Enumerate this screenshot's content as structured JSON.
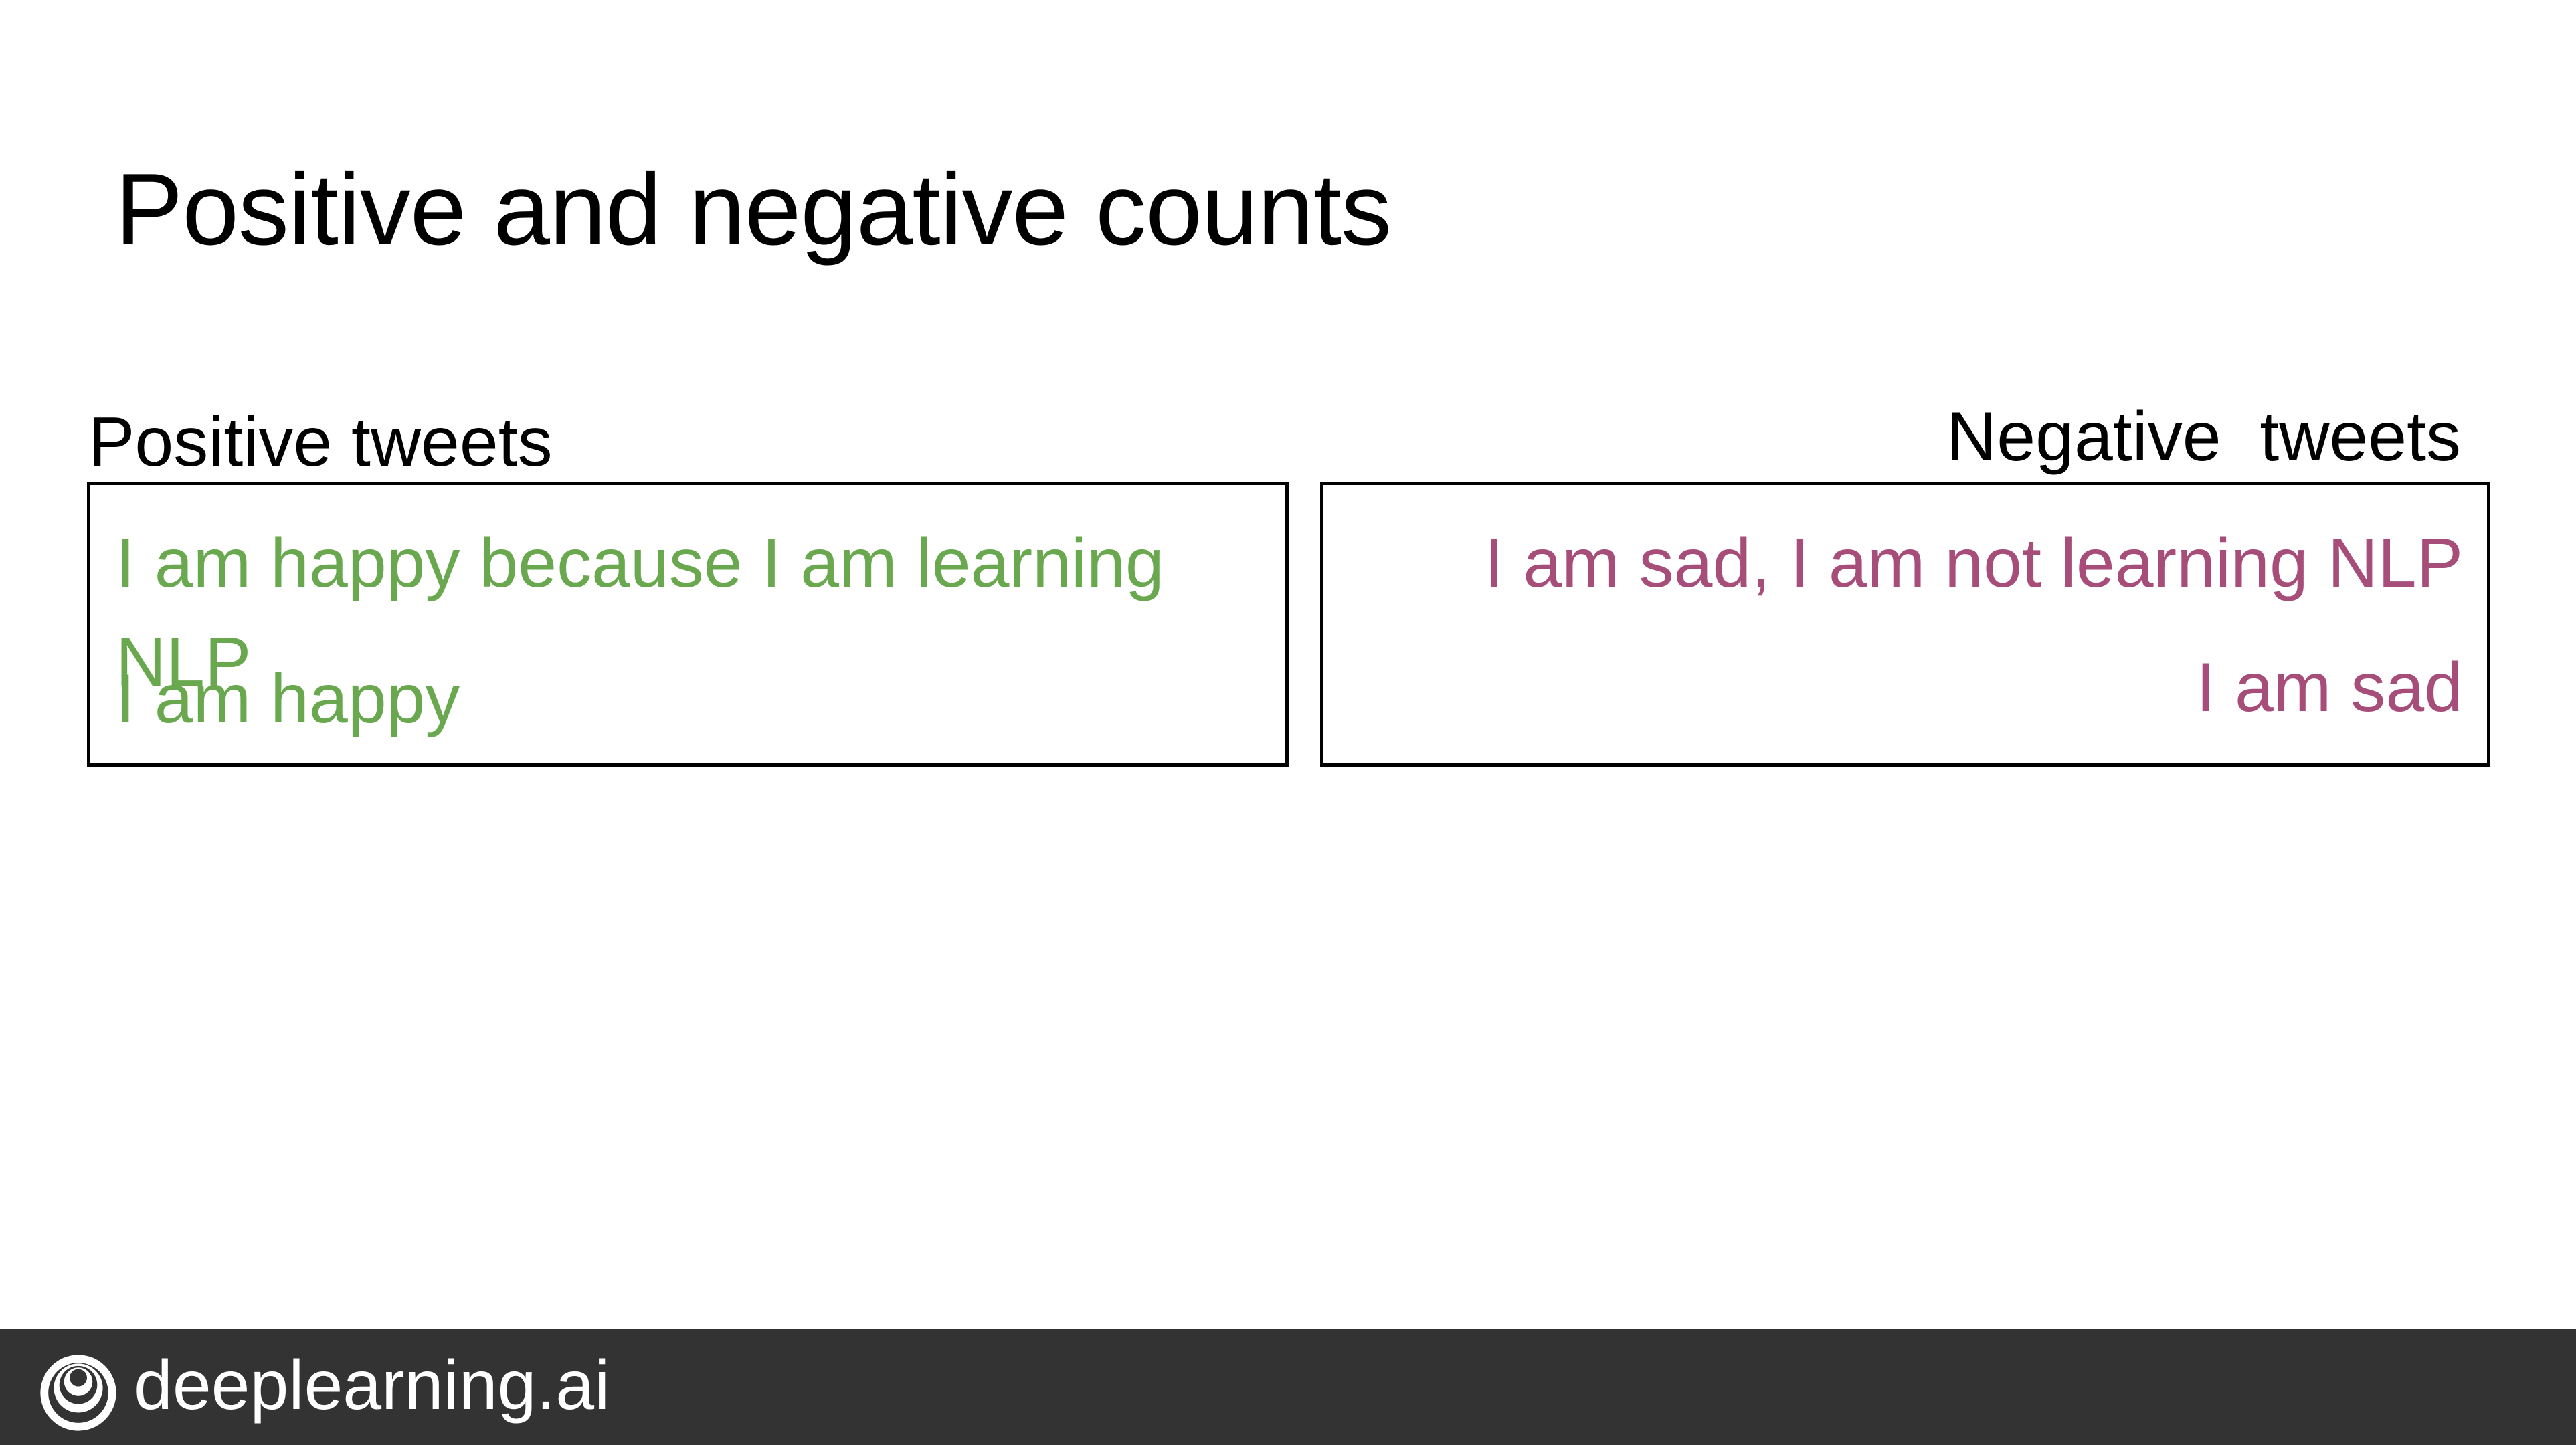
{
  "slide": {
    "title": "Positive and negative counts"
  },
  "positive": {
    "label": "Positive tweets",
    "color": "#6aa84f",
    "tweets": [
      "I am happy because I am learning NLP",
      "I am happy"
    ]
  },
  "negative": {
    "label": "Negative  tweets",
    "color": "#a64d79",
    "tweets": [
      "I am sad, I am not learning NLP",
      "I am sad"
    ]
  },
  "footer": {
    "brand": "deeplearning.ai",
    "logo_icon": "deeplearning-logo-icon",
    "background": "#333333"
  }
}
